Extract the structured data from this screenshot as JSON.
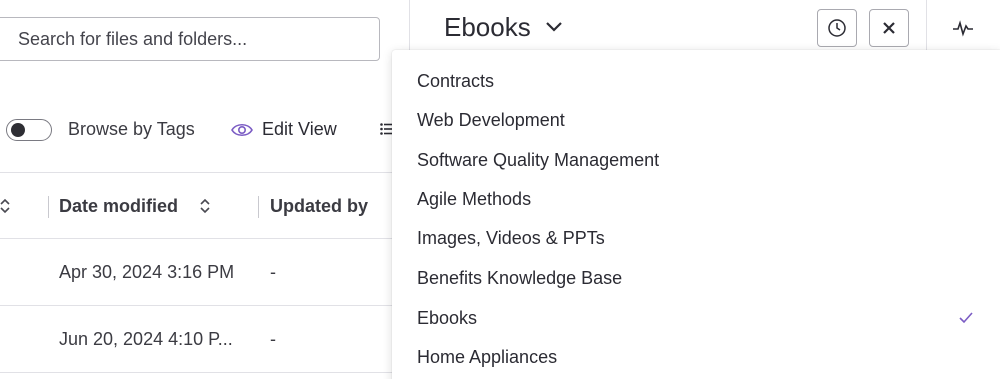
{
  "search": {
    "placeholder": "Search for files and folders..."
  },
  "toolbar": {
    "browse_by_tags_label": "Browse by Tags",
    "browse_by_tags_enabled": false,
    "edit_view_label": "Edit View"
  },
  "table": {
    "columns": [
      {
        "label": "Date modified"
      },
      {
        "label": "Updated by"
      }
    ],
    "rows": [
      {
        "date_modified": "Apr 30, 2024 3:16 PM",
        "updated_by": "-"
      },
      {
        "date_modified": "Jun 20, 2024 4:10 P...",
        "updated_by": "-"
      }
    ]
  },
  "panel": {
    "title": "Ebooks",
    "accent_color": "#7b5cc4"
  },
  "dropdown": {
    "items": [
      {
        "label": "Contracts",
        "selected": false
      },
      {
        "label": "Web Development",
        "selected": false
      },
      {
        "label": "Software Quality Management",
        "selected": false
      },
      {
        "label": "Agile Methods",
        "selected": false
      },
      {
        "label": "Images, Videos & PPTs",
        "selected": false
      },
      {
        "label": "Benefits Knowledge Base",
        "selected": false
      },
      {
        "label": "Ebooks",
        "selected": true
      },
      {
        "label": "Home Appliances",
        "selected": false
      }
    ]
  },
  "icons": {
    "eye": "eye-icon",
    "list": "list-icon",
    "sort": "sort-icon",
    "chevron": "chevron-down-icon",
    "history": "clock-icon",
    "close": "close-icon",
    "activity": "activity-icon",
    "check": "check-icon"
  }
}
